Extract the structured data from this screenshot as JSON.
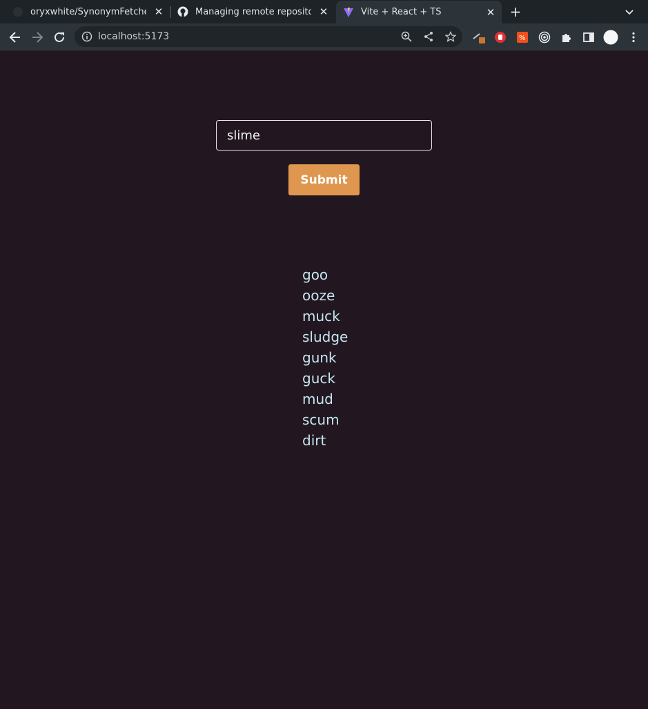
{
  "browser": {
    "tabs": [
      {
        "title": "oryxwhite/SynonymFetcher",
        "icon": "github-icon",
        "active": false
      },
      {
        "title": "Managing remote repositories",
        "icon": "github-icon",
        "active": false
      },
      {
        "title": "Vite + React + TS",
        "icon": "vite-icon",
        "active": true
      }
    ],
    "url": "localhost:5173"
  },
  "form": {
    "input_value": "slime",
    "submit_label": "Submit"
  },
  "synonyms": [
    "goo",
    "ooze",
    "muck",
    "sludge",
    "gunk",
    "guck",
    "mud",
    "scum",
    "dirt"
  ],
  "colors": {
    "page_background": "#221720",
    "button_background": "#df974f",
    "result_text": "#c5e6ef"
  }
}
